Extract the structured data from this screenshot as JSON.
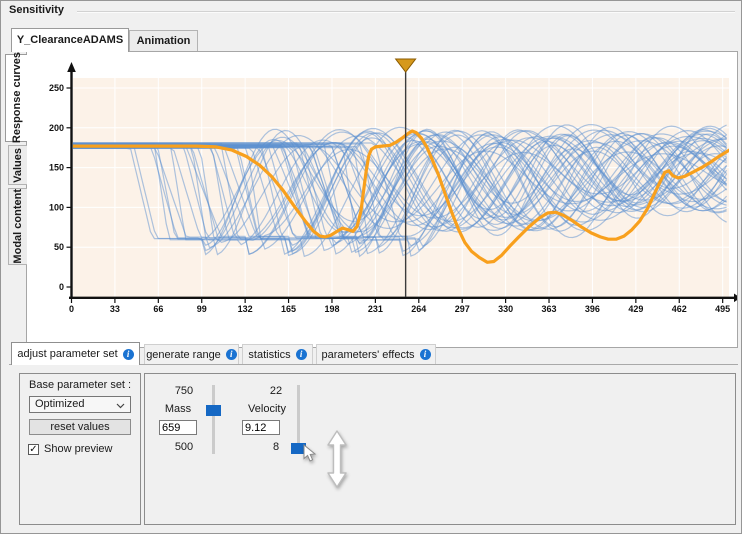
{
  "window": {
    "title": "Sensitivity"
  },
  "top_tabs": [
    {
      "label": "Y_ClearanceADAMS",
      "active": true
    },
    {
      "label": "Animation",
      "active": false
    }
  ],
  "side_tabs": [
    {
      "label": "Response curves",
      "active": true
    },
    {
      "label": "Values",
      "active": false
    },
    {
      "label": "Modal content",
      "active": false
    }
  ],
  "bottom_tabs": [
    {
      "label": "adjust parameter set",
      "active": true
    },
    {
      "label": "generate range",
      "active": false
    },
    {
      "label": "statistics",
      "active": false
    },
    {
      "label": "parameters' effects",
      "active": false
    }
  ],
  "base_parameter_panel": {
    "label": "Base parameter set :",
    "dropdown_value": "Optimized",
    "reset_button": "reset values",
    "show_preview_label": "Show preview",
    "show_preview_checked": true
  },
  "sliders": [
    {
      "name": "Mass",
      "max_label": "750",
      "min_label": "500",
      "value": "659",
      "min": 500,
      "max": 750,
      "current": 659
    },
    {
      "name": "Velocity",
      "max_label": "22",
      "min_label": "8",
      "value": "9.12",
      "min": 8,
      "max": 22,
      "current": 9.12
    }
  ],
  "icons": {
    "info": "i",
    "check": "✓"
  },
  "chart_data": {
    "type": "line",
    "title": "",
    "xlabel": "",
    "ylabel": "",
    "xlim": [
      0,
      500
    ],
    "ylim": [
      -14,
      262
    ],
    "x_ticks": [
      0,
      33,
      66,
      99,
      132,
      165,
      198,
      231,
      264,
      297,
      330,
      363,
      396,
      429,
      462,
      495
    ],
    "y_ticks": [
      0,
      50,
      100,
      150,
      200,
      250
    ],
    "grid": true,
    "marker_x": 254,
    "colors": {
      "background": "#fcf2e8",
      "grid": "#ffffff",
      "ensemble": "#5b8fd0",
      "highlight": "#f8a01d",
      "marker_line": "#3c3c3c",
      "marker_handle_fill": "#d6991c",
      "marker_handle_stroke": "#8a5a00",
      "axis": "#111111"
    },
    "highlight_curve": {
      "points": [
        [
          0,
          177
        ],
        [
          60,
          177
        ],
        [
          95,
          177
        ],
        [
          110,
          176
        ],
        [
          122,
          172
        ],
        [
          133,
          164
        ],
        [
          143,
          153
        ],
        [
          152,
          139
        ],
        [
          161,
          121
        ],
        [
          170,
          100
        ],
        [
          178,
          82
        ],
        [
          184,
          70
        ],
        [
          189,
          64
        ],
        [
          193,
          63
        ],
        [
          197,
          65
        ],
        [
          202,
          70
        ],
        [
          206,
          74
        ],
        [
          210,
          72
        ],
        [
          214,
          70
        ],
        [
          217,
          76
        ],
        [
          220,
          95
        ],
        [
          222,
          120
        ],
        [
          224,
          146
        ],
        [
          226,
          165
        ],
        [
          228,
          173
        ],
        [
          231,
          176
        ],
        [
          236,
          177
        ],
        [
          242,
          178
        ],
        [
          247,
          182
        ],
        [
          252,
          188
        ],
        [
          256,
          193
        ],
        [
          259,
          196
        ],
        [
          262,
          194
        ],
        [
          266,
          187
        ],
        [
          270,
          176
        ],
        [
          274,
          161
        ],
        [
          279,
          141
        ],
        [
          284,
          117
        ],
        [
          289,
          94
        ],
        [
          294,
          73
        ],
        [
          299,
          56
        ],
        [
          304,
          45
        ],
        [
          310,
          37
        ],
        [
          316,
          31
        ],
        [
          321,
          32
        ],
        [
          327,
          40
        ],
        [
          333,
          51
        ],
        [
          340,
          63
        ],
        [
          348,
          76
        ],
        [
          356,
          87
        ],
        [
          362,
          93
        ],
        [
          368,
          94
        ],
        [
          374,
          90
        ],
        [
          381,
          83
        ],
        [
          388,
          75
        ],
        [
          395,
          68
        ],
        [
          402,
          63
        ],
        [
          408,
          60
        ],
        [
          414,
          60
        ],
        [
          420,
          64
        ],
        [
          426,
          72
        ],
        [
          432,
          83
        ],
        [
          438,
          99
        ],
        [
          443,
          117
        ],
        [
          448,
          134
        ],
        [
          451,
          144
        ],
        [
          454,
          146
        ],
        [
          457,
          140
        ],
        [
          461,
          137
        ],
        [
          466,
          139
        ],
        [
          472,
          144
        ],
        [
          479,
          150
        ],
        [
          486,
          157
        ],
        [
          493,
          165
        ],
        [
          500,
          172
        ]
      ]
    },
    "ensemble": {
      "count": 44,
      "x_max": 500,
      "x_step": 3,
      "flat_y_range": [
        174,
        181
      ],
      "bottom_y_base": 59,
      "drop_start_range": [
        48,
        226
      ],
      "drop_width_range": [
        10,
        28
      ],
      "bottom_hold_range": [
        8,
        42
      ],
      "period_range": [
        105,
        150
      ],
      "amplitude": 58,
      "amp_factor_range": [
        0.95,
        1.45
      ],
      "center_start": 120,
      "center_drift_range": [
        0.05,
        0.13
      ],
      "center_max": 158,
      "amp_decay": 520,
      "opacity": 0.5,
      "stroke_width": 1.2
    }
  }
}
